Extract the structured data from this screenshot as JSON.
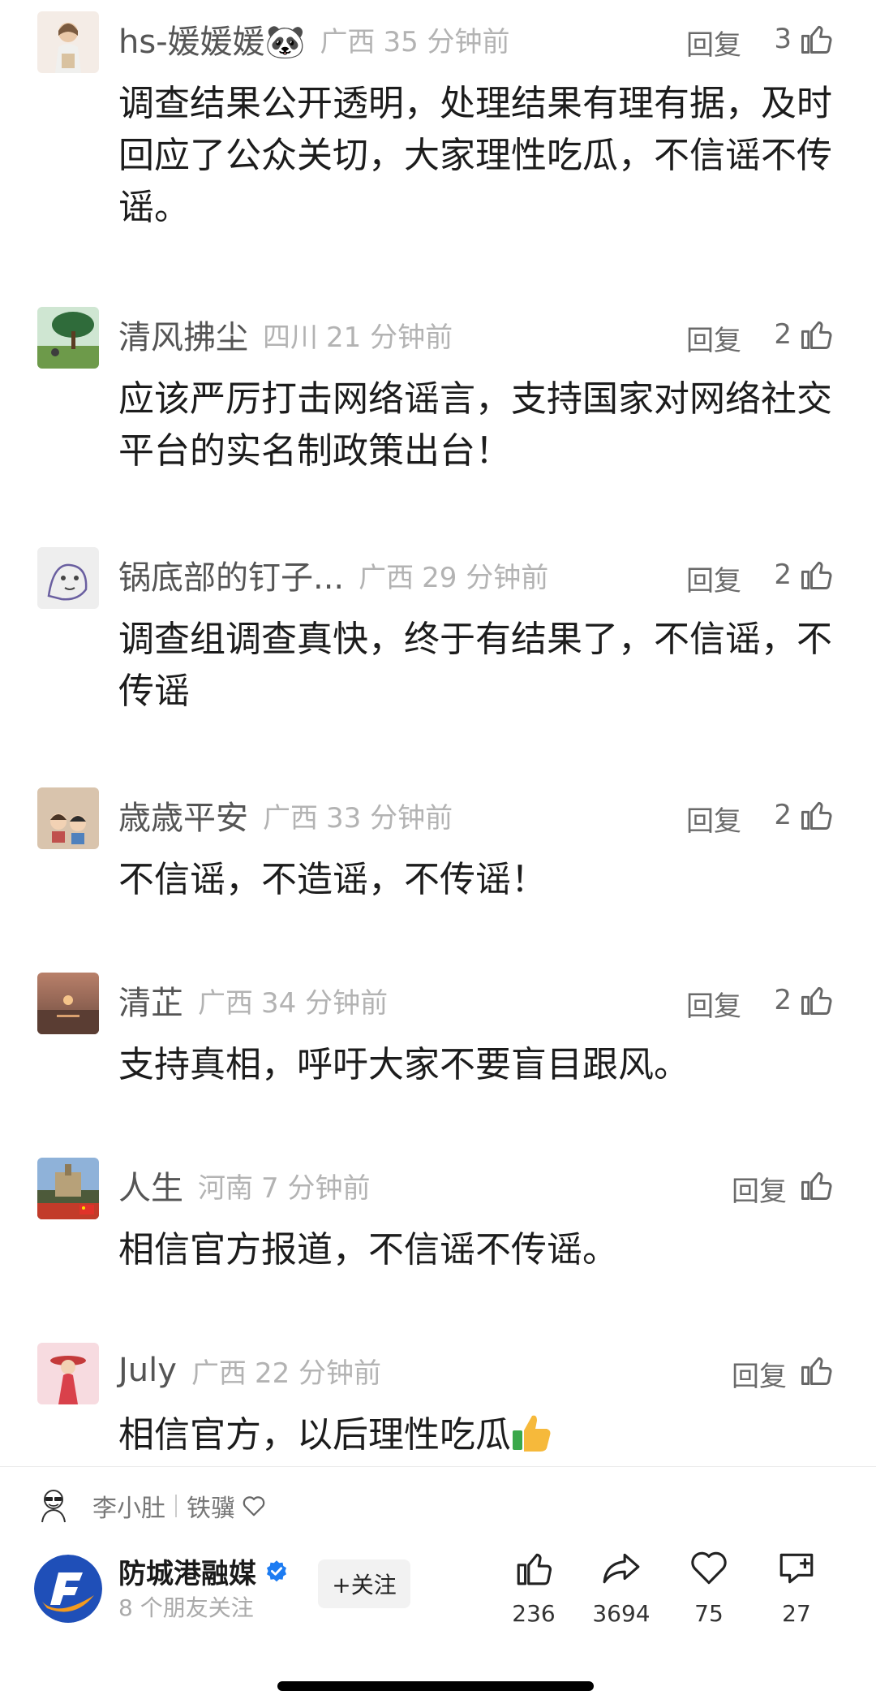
{
  "comments": [
    {
      "name": "hs-媛媛媛🐼",
      "region": "广西",
      "time": "35 分钟前",
      "reply": "回复",
      "likes": "3",
      "text": "调查结果公开透明，处理结果有理有据，及时回应了公众关切，大家理性吃瓜，不信谣不传谣。"
    },
    {
      "name": "清风拂尘",
      "region": "四川",
      "time": "21 分钟前",
      "reply": "回复",
      "likes": "2",
      "text": "应该严厉打击网络谣言，支持国家对网络社交平台的实名制政策出台！"
    },
    {
      "name": "锅底部的钉子...",
      "region": "广西",
      "time": "29 分钟前",
      "reply": "回复",
      "likes": "2",
      "text": "调查组调查真快，终于有结果了，不信谣，不传谣"
    },
    {
      "name": "歳歳平安",
      "region": "广西",
      "time": "33 分钟前",
      "reply": "回复",
      "likes": "2",
      "text": "不信谣，不造谣，不传谣！"
    },
    {
      "name": "清芷",
      "region": "广西",
      "time": "34 分钟前",
      "reply": "回复",
      "likes": "2",
      "text": "支持真相，呼吁大家不要盲目跟风。"
    },
    {
      "name": "人生",
      "region": "河南",
      "time": "7 分钟前",
      "reply": "回复",
      "likes": "",
      "text": "相信官方报道，不信谣不传谣。"
    },
    {
      "name": "July",
      "region": "广西",
      "time": "22 分钟前",
      "reply": "回复",
      "likes": "",
      "text": "相信官方，以后理性吃瓜"
    }
  ],
  "editor": {
    "name": "李小肚",
    "role": "铁骥"
  },
  "publisher": {
    "name": "防城港融媒",
    "friends": "8 个朋友关注",
    "follow": "+关注"
  },
  "actions": {
    "like": "236",
    "share": "3694",
    "favorite": "75",
    "comment": "27"
  },
  "colors": {
    "meta": "#b3b3b3",
    "verified": "#1d7cf2",
    "logo_blue": "#1f4fb8",
    "logo_orange": "#f39a1e"
  }
}
